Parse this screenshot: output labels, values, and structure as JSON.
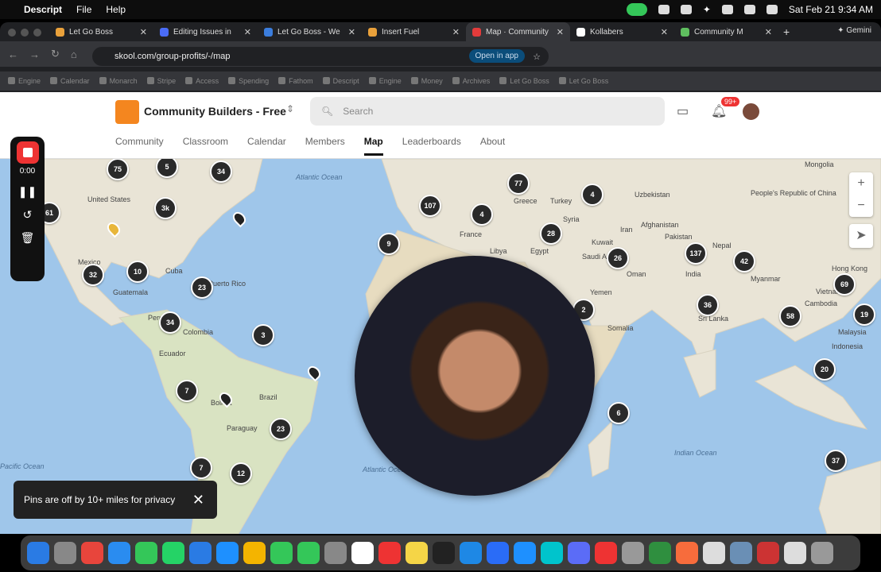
{
  "menubar": {
    "app": "Descript",
    "items": [
      "File",
      "Help"
    ],
    "clock": "Sat Feb 21  9:34 AM"
  },
  "tabs": [
    {
      "title": "Let Go Boss",
      "color": "#e9a13b"
    },
    {
      "title": "Editing Issues in",
      "color": "#4a6cf7"
    },
    {
      "title": "Let Go Boss - We",
      "color": "#3b7ddd"
    },
    {
      "title": "Insert Fuel",
      "color": "#e9a13b"
    },
    {
      "title": "Map · Community",
      "color": "#e33b3b",
      "active": true
    },
    {
      "title": "Kollabers",
      "color": "#ffffff"
    },
    {
      "title": "Community M",
      "color": "#5fbf5f"
    }
  ],
  "gemini": "Gemini",
  "url": "skool.com/group-profits/-/map",
  "open_in_app": "Open in app",
  "bookmarks": [
    "Engine",
    "Calendar",
    "Monarch",
    "Stripe",
    "Access",
    "Spending",
    "Fathom",
    "Descript",
    "Engine",
    "Money",
    "Archives",
    "Let Go Boss",
    "Let Go Boss"
  ],
  "group_name": "Community Builders - Free",
  "search_placeholder": "Search",
  "notif_badge": "99+",
  "nav": [
    "Community",
    "Classroom",
    "Calendar",
    "Members",
    "Map",
    "Leaderboards",
    "About"
  ],
  "map": {
    "labels": {
      "atlantic": "Atlantic Ocean",
      "atlantic2": "Atlantic Ocean",
      "pacific": "Pacific Ocean",
      "indian": "Indian Ocean",
      "us": "United States",
      "mexico": "Mexico",
      "cuba": "Cuba",
      "pr": "Puerto Rico",
      "guatemala": "Guatemala",
      "colombia": "Colombia",
      "ecuador": "Ecuador",
      "brazil": "Brazil",
      "paraguay": "Paraguay",
      "bolivia": "Bolivia",
      "peru": "Peru",
      "france": "France",
      "greece": "Greece",
      "turkey": "Turkey",
      "syria": "Syria",
      "libya": "Libya",
      "egypt": "Egypt",
      "saudi": "Saudi Arabia",
      "kuwait": "Kuwait",
      "iran": "Iran",
      "oman": "Oman",
      "yemen": "Yemen",
      "somalia": "Somalia",
      "uzbek": "Uzbekistan",
      "afghan": "Afghanistan",
      "pakistan": "Pakistan",
      "nepal": "Nepal",
      "india": "India",
      "mongolia": "Mongolia",
      "china": "People's Republic of China",
      "myanmar": "Myanmar",
      "hk": "Hong Kong",
      "vietnam": "Vietnam",
      "cambodia": "Cambodia",
      "srilanka": "Sri Lanka",
      "malaysia": "Malaysia",
      "indonesia": "Indonesia"
    },
    "clusters": [
      "75",
      "5",
      "34",
      "3k",
      "61",
      "32",
      "10",
      "23",
      "34",
      "3",
      "7",
      "23",
      "7",
      "12",
      "107",
      "77",
      "4",
      "4",
      "9",
      "28",
      "26",
      "137",
      "42",
      "69",
      "36",
      "2",
      "58",
      "19",
      "20",
      "6",
      "37"
    ]
  },
  "toast": "Pins are off by 10+ miles for privacy",
  "recorder": {
    "time": "0:00"
  },
  "dock_colors": [
    "#2a7be4",
    "#888",
    "#e8453c",
    "#2a8cf0",
    "#34c759",
    "#25d366",
    "#2a7be4",
    "#1e90ff",
    "#f4b400",
    "#34c759",
    "#34c759",
    "#888",
    "#fff",
    "#e33",
    "#f5d547",
    "#222",
    "#1e88e5",
    "#2a6cf7",
    "#1e90ff",
    "#00c4cc",
    "#5b6cf7",
    "#e33",
    "#999",
    "#2f8f3f",
    "#f76c3c",
    "#ddd",
    "#6a8fb5",
    "#c33",
    "#ddd",
    "#999"
  ]
}
